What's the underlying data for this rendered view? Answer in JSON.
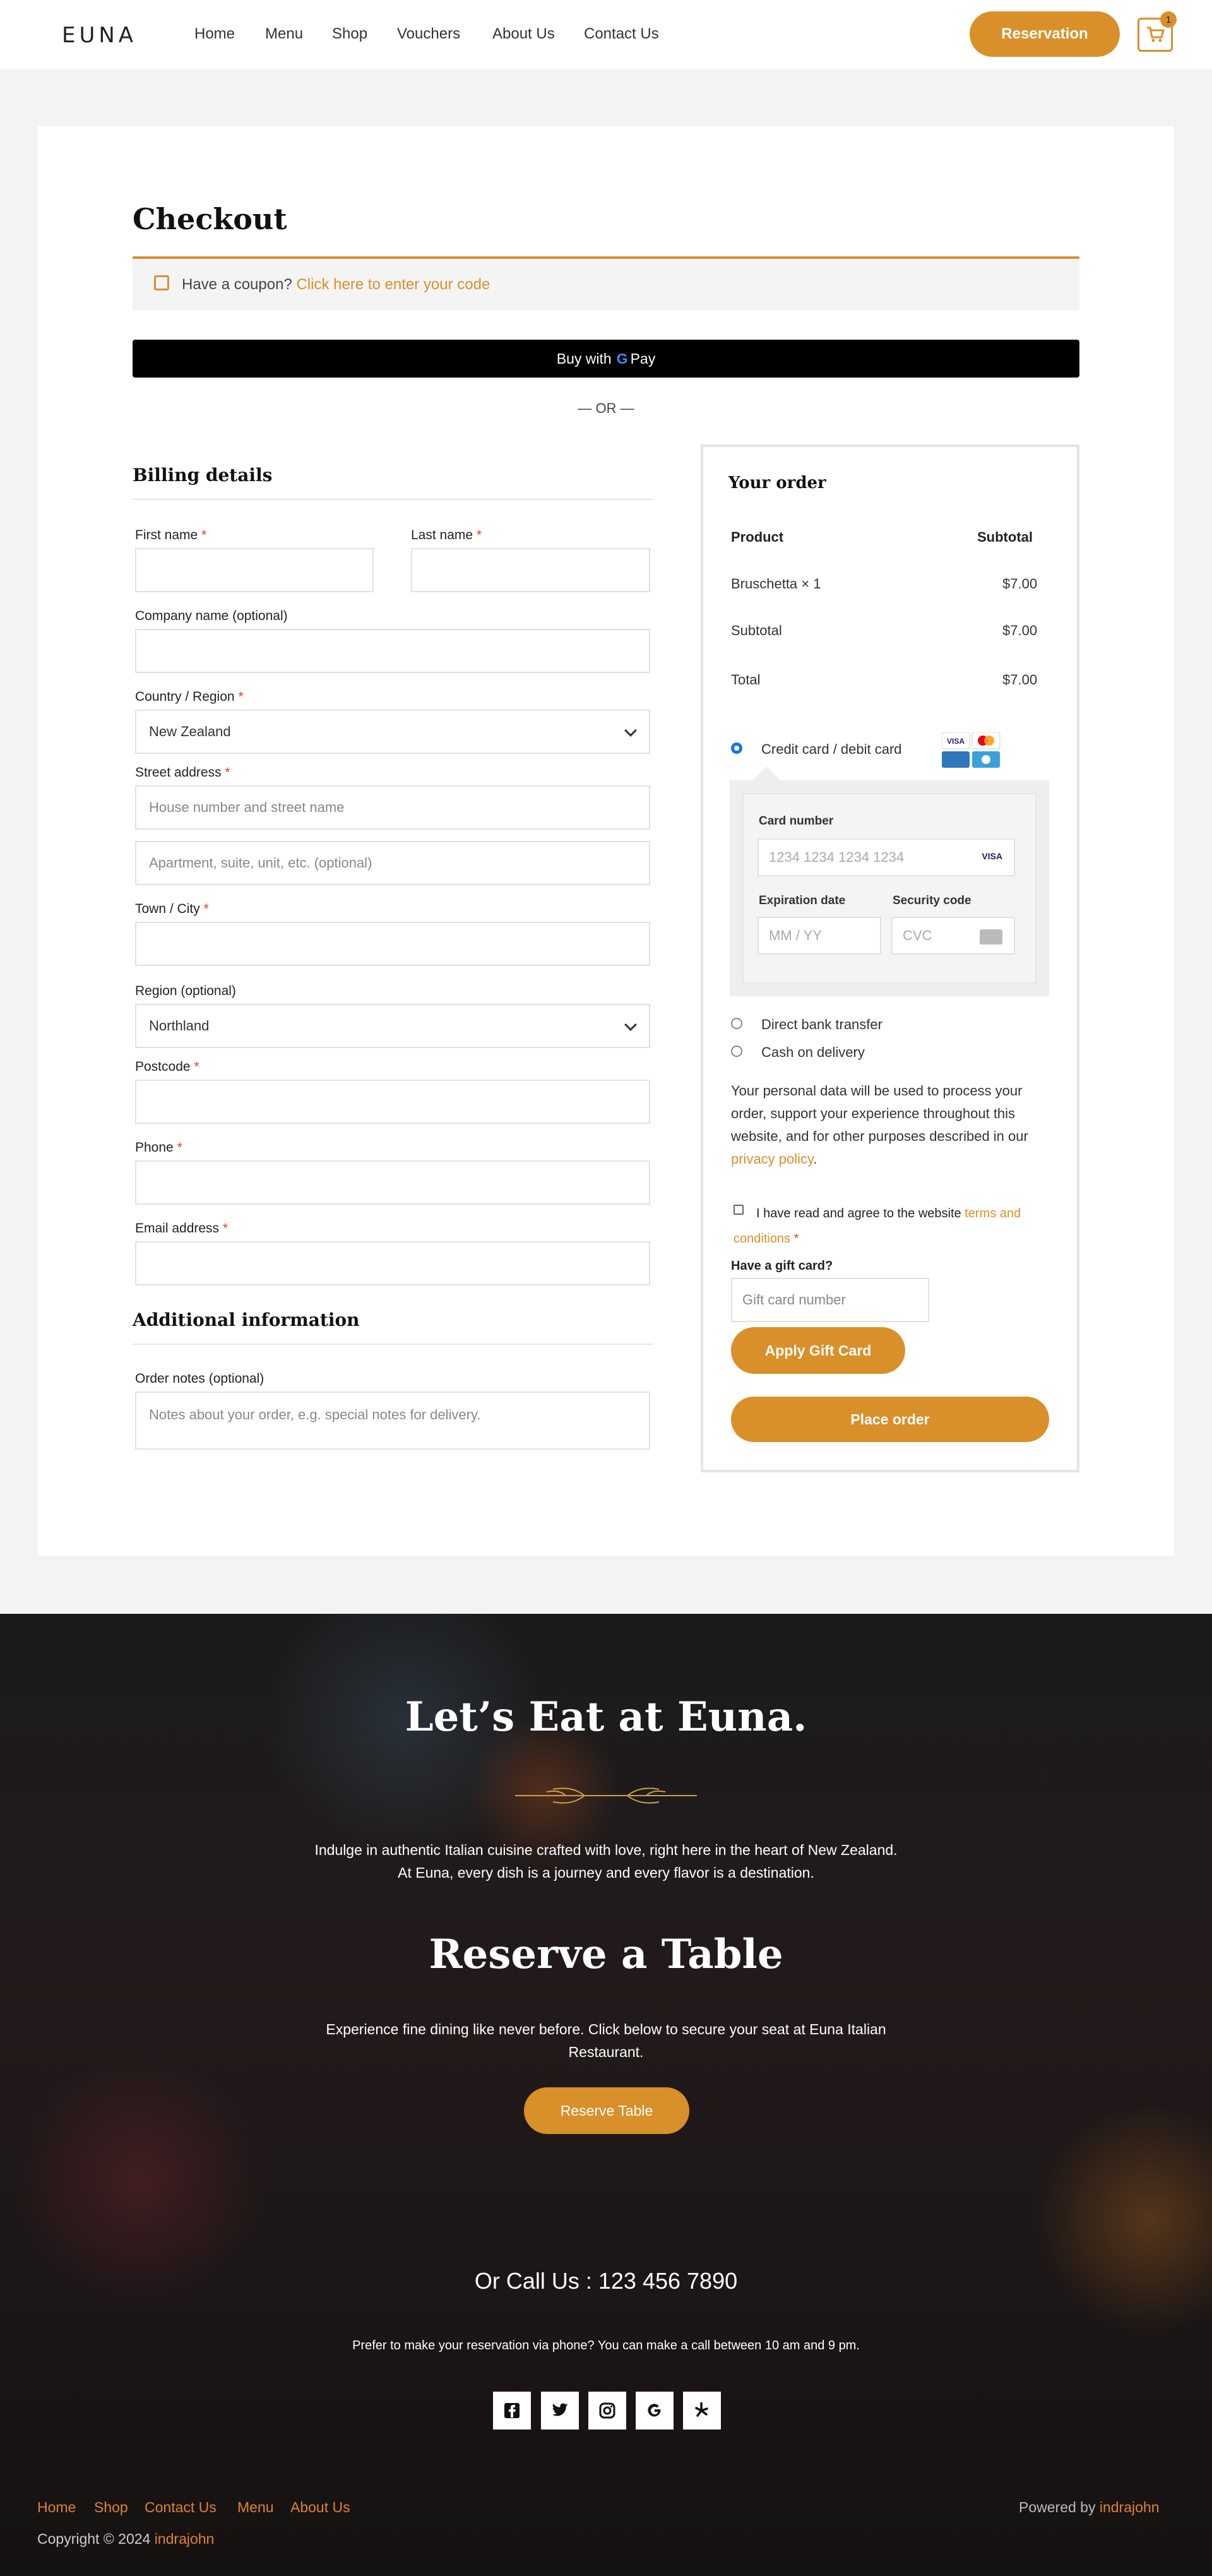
{
  "header": {
    "logo": "EUNA",
    "nav": [
      "Home",
      "Menu",
      "Shop",
      "Vouchers",
      "About Us",
      "Contact Us"
    ],
    "reservation_label": "Reservation",
    "cart_count": "1"
  },
  "checkout": {
    "title": "Checkout",
    "coupon_text": "Have a coupon?",
    "coupon_link": "Click here to enter your code",
    "gpay_label": "Buy with",
    "gpay_brand": "Pay",
    "or_label": "— OR —"
  },
  "billing": {
    "title": "Billing details",
    "first_name": "First name",
    "last_name": "Last name",
    "company": "Company name (optional)",
    "country": "Country / Region",
    "country_value": "New Zealand",
    "street": "Street address",
    "street_placeholder": "House number and street name",
    "apartment_placeholder": "Apartment, suite, unit, etc. (optional)",
    "town": "Town / City",
    "region": "Region (optional)",
    "region_value": "Northland",
    "postcode": "Postcode",
    "phone": "Phone",
    "email": "Email address",
    "required": "*"
  },
  "additional": {
    "title": "Additional information",
    "notes_label": "Order notes (optional)",
    "notes_placeholder": "Notes about your order, e.g. special notes for delivery."
  },
  "order": {
    "title": "Your order",
    "col_product": "Product",
    "col_subtotal": "Subtotal",
    "item_name": "Bruschetta × 1",
    "item_price": "$7.00",
    "subtotal_label": "Subtotal",
    "subtotal_value": "$7.00",
    "total_label": "Total",
    "total_value": "$7.00",
    "pay_card": "Credit card / debit card",
    "card_number_label": "Card number",
    "card_number_placeholder": "1234 1234 1234 1234",
    "expiry_label": "Expiration date",
    "expiry_placeholder": "MM / YY",
    "cvc_label": "Security code",
    "cvc_placeholder": "CVC",
    "pay_bank": "Direct bank transfer",
    "pay_cod": "Cash on delivery",
    "privacy_text": "Your personal data will be used to process your order, support your experience throughout this website, and for other purposes described in our",
    "privacy_link": "privacy policy",
    "terms_text": "I have read and agree to the website",
    "terms_link_1": "terms",
    "terms_link_2": "and conditions",
    "gift_label": "Have a gift card?",
    "gift_placeholder": "Gift card number",
    "apply_gift": "Apply Gift Card",
    "place_order": "Place order"
  },
  "footer": {
    "heading": "Let’s Eat at Euna.",
    "intro": "Indulge in authentic Italian cuisine crafted with love, right here in the heart of New Zealand. At Euna, every dish is a journey and every flavor is a destination.",
    "reserve_heading": "Reserve a Table",
    "reserve_text": "Experience fine dining like never before. Click below to secure your seat at Euna Italian Restaurant.",
    "reserve_button": "Reserve Table",
    "call": "Or Call Us : 123 456 7890",
    "call_note": "Prefer to make your reservation via phone? You can make a call between 10 am and 9 pm.",
    "links": [
      "Home",
      "Shop",
      "Contact Us",
      "Menu",
      "About Us"
    ],
    "copyright": "Copyright © 2024",
    "author": "indrajohn",
    "powered": "Powered by",
    "powered_author": "indrajohn"
  },
  "colors": {
    "accent": "#d9902a",
    "link_orange": "#e0822d",
    "dark": "#000000"
  }
}
